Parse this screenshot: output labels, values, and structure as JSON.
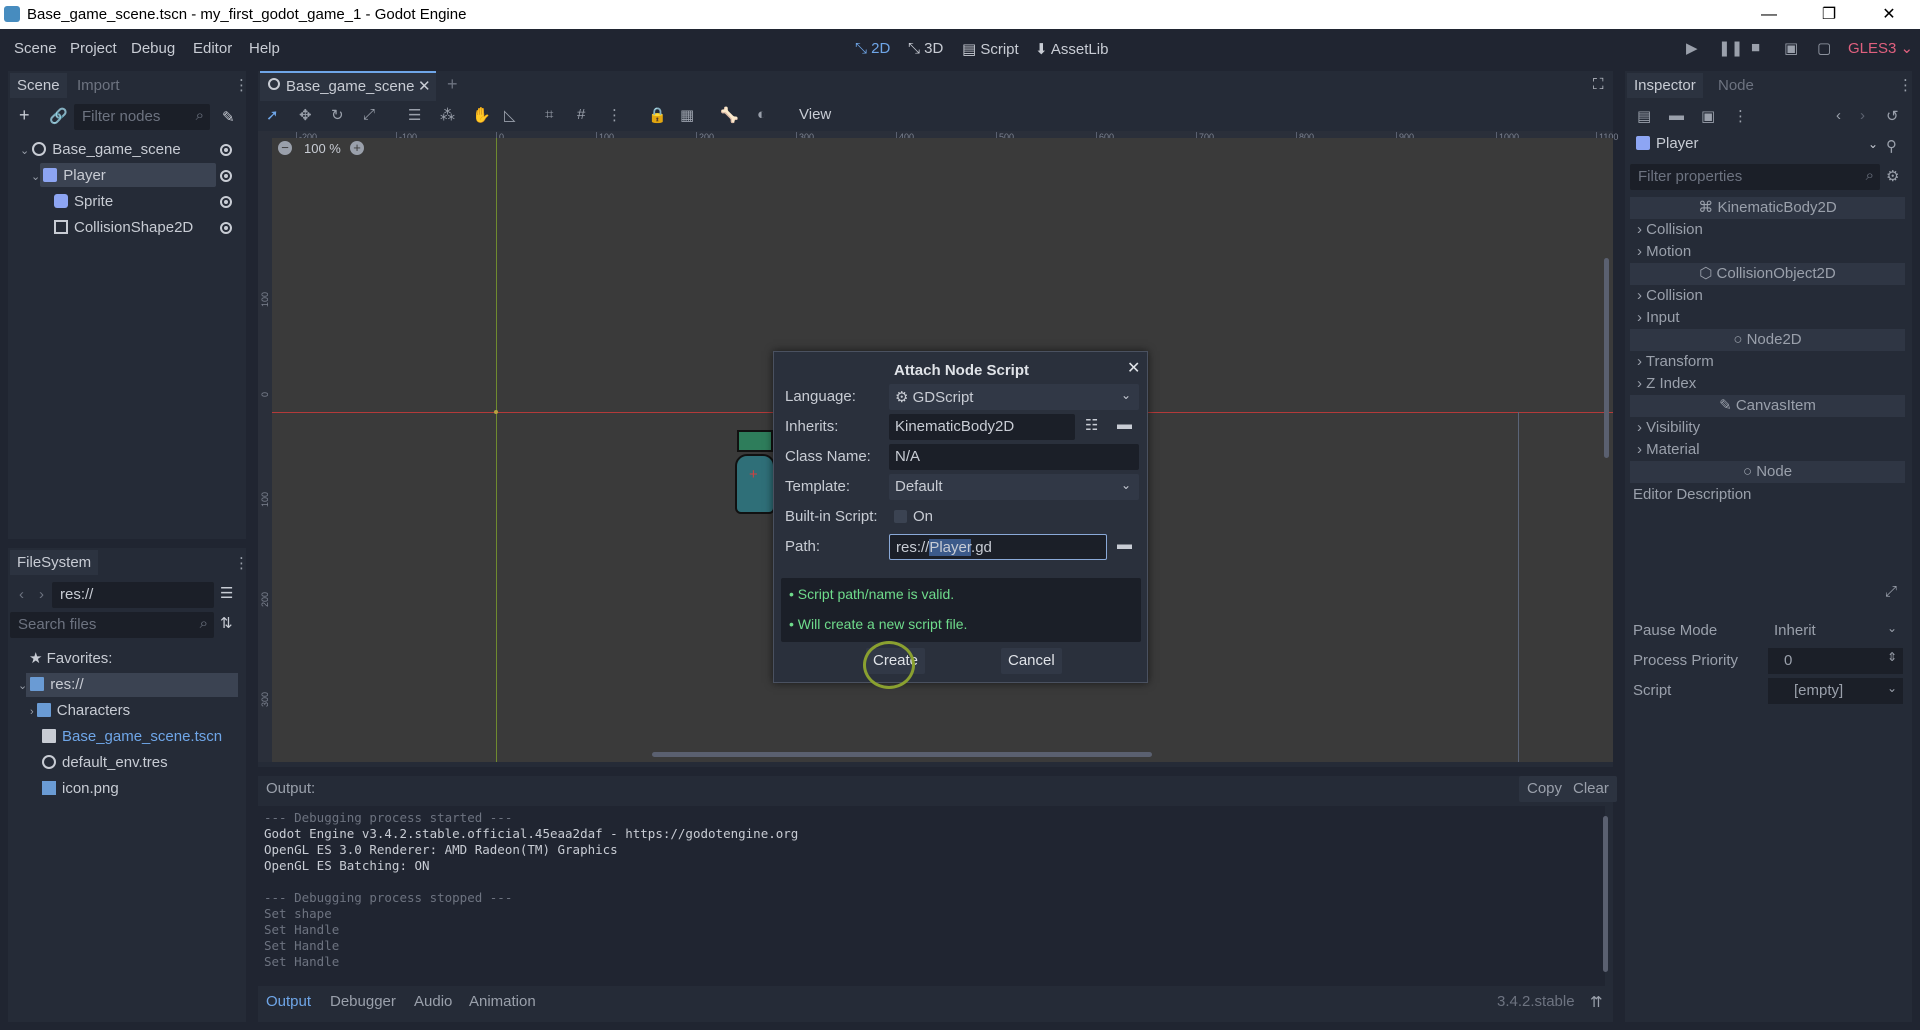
{
  "window": {
    "title": "Base_game_scene.tscn - my_first_godot_game_1 - Godot Engine",
    "minimize": "—",
    "restore": "❐",
    "close": "✕"
  },
  "menu": [
    "Scene",
    "Project",
    "Debug",
    "Editor",
    "Help"
  ],
  "workspaces": [
    {
      "label": "2D",
      "active": true
    },
    {
      "label": "3D",
      "active": false
    },
    {
      "label": "Script",
      "active": false
    },
    {
      "label": "AssetLib",
      "active": false
    }
  ],
  "renderer": "GLES3",
  "scene_dock": {
    "tabs": [
      "Scene",
      "Import"
    ],
    "filter_placeholder": "Filter nodes",
    "nodes": [
      {
        "name": "Base_game_scene",
        "icon": "node2d-icon"
      },
      {
        "name": "Player",
        "icon": "kinematic-body-icon"
      },
      {
        "name": "Sprite",
        "icon": "sprite-icon"
      },
      {
        "name": "CollisionShape2D",
        "icon": "collision-shape-icon"
      }
    ]
  },
  "filesystem": {
    "tab": "FileSystem",
    "path": "res://",
    "search_placeholder": "Search files",
    "favorites": "Favorites:",
    "items": [
      {
        "name": "res://",
        "icon": "folder-icon"
      },
      {
        "name": "Characters",
        "icon": "folder-icon"
      },
      {
        "name": "Base_game_scene.tscn",
        "icon": "scene-icon"
      },
      {
        "name": "default_env.tres",
        "icon": "environment-icon"
      },
      {
        "name": "icon.png",
        "icon": "image-icon"
      }
    ]
  },
  "editor": {
    "scene_tab": "Base_game_scene",
    "view_menu": "View",
    "zoom": "100 %",
    "ruler_ticks": [
      "-200",
      "-100",
      "0",
      "100",
      "200",
      "300",
      "400",
      "500",
      "600",
      "700",
      "800",
      "900",
      "1000",
      "1100"
    ],
    "vruler_ticks": [
      "100",
      "0",
      "100",
      "200",
      "300"
    ]
  },
  "dialog": {
    "title": "Attach Node Script",
    "language_label": "Language:",
    "language_value": "GDScript",
    "inherits_label": "Inherits:",
    "inherits_value": "KinematicBody2D",
    "classname_label": "Class Name:",
    "classname_value": "N/A",
    "template_label": "Template:",
    "template_value": "Default",
    "builtin_label": "Built-in Script:",
    "builtin_value": "On",
    "path_label": "Path:",
    "path_prefix": "res://",
    "path_selected": "Player",
    "path_suffix": ".gd",
    "messages": [
      "• Script path/name is valid.",
      "• Will create a new script file."
    ],
    "create": "Create",
    "cancel": "Cancel"
  },
  "inspector": {
    "tabs": [
      "Inspector",
      "Node"
    ],
    "object": "Player",
    "filter_placeholder": "Filter properties",
    "sections": [
      {
        "type": "category",
        "label": "KinematicBody2D"
      },
      {
        "type": "group",
        "label": "Collision"
      },
      {
        "type": "group",
        "label": "Motion"
      },
      {
        "type": "category",
        "label": "CollisionObject2D"
      },
      {
        "type": "group",
        "label": "Collision"
      },
      {
        "type": "group",
        "label": "Input"
      },
      {
        "type": "category",
        "label": "Node2D"
      },
      {
        "type": "group",
        "label": "Transform"
      },
      {
        "type": "group",
        "label": "Z Index"
      },
      {
        "type": "category",
        "label": "CanvasItem"
      },
      {
        "type": "group",
        "label": "Visibility"
      },
      {
        "type": "group",
        "label": "Material"
      },
      {
        "type": "category",
        "label": "Node"
      }
    ],
    "editor_description": "Editor Description",
    "props": [
      {
        "label": "Pause Mode",
        "value": "Inherit"
      },
      {
        "label": "Process Priority",
        "value": "0"
      },
      {
        "label": "Script",
        "value": "[empty]"
      }
    ]
  },
  "output": {
    "label": "Output:",
    "copy": "Copy",
    "clear": "Clear",
    "lines": [
      {
        "text": "--- Debugging process started ---",
        "dim": true
      },
      {
        "text": "Godot Engine v3.4.2.stable.official.45eaa2daf - https://godotengine.org",
        "dim": false
      },
      {
        "text": "OpenGL ES 3.0 Renderer: AMD Radeon(TM) Graphics",
        "dim": false
      },
      {
        "text": "OpenGL ES Batching: ON",
        "dim": false
      },
      {
        "text": "",
        "dim": false
      },
      {
        "text": "--- Debugging process stopped ---",
        "dim": true
      },
      {
        "text": "Set shape",
        "dim": true
      },
      {
        "text": "Set Handle",
        "dim": true
      },
      {
        "text": "Set Handle",
        "dim": true
      },
      {
        "text": "Set Handle",
        "dim": true
      }
    ],
    "bottom_tabs": [
      "Output",
      "Debugger",
      "Audio",
      "Animation"
    ],
    "version": "3.4.2.stable"
  }
}
